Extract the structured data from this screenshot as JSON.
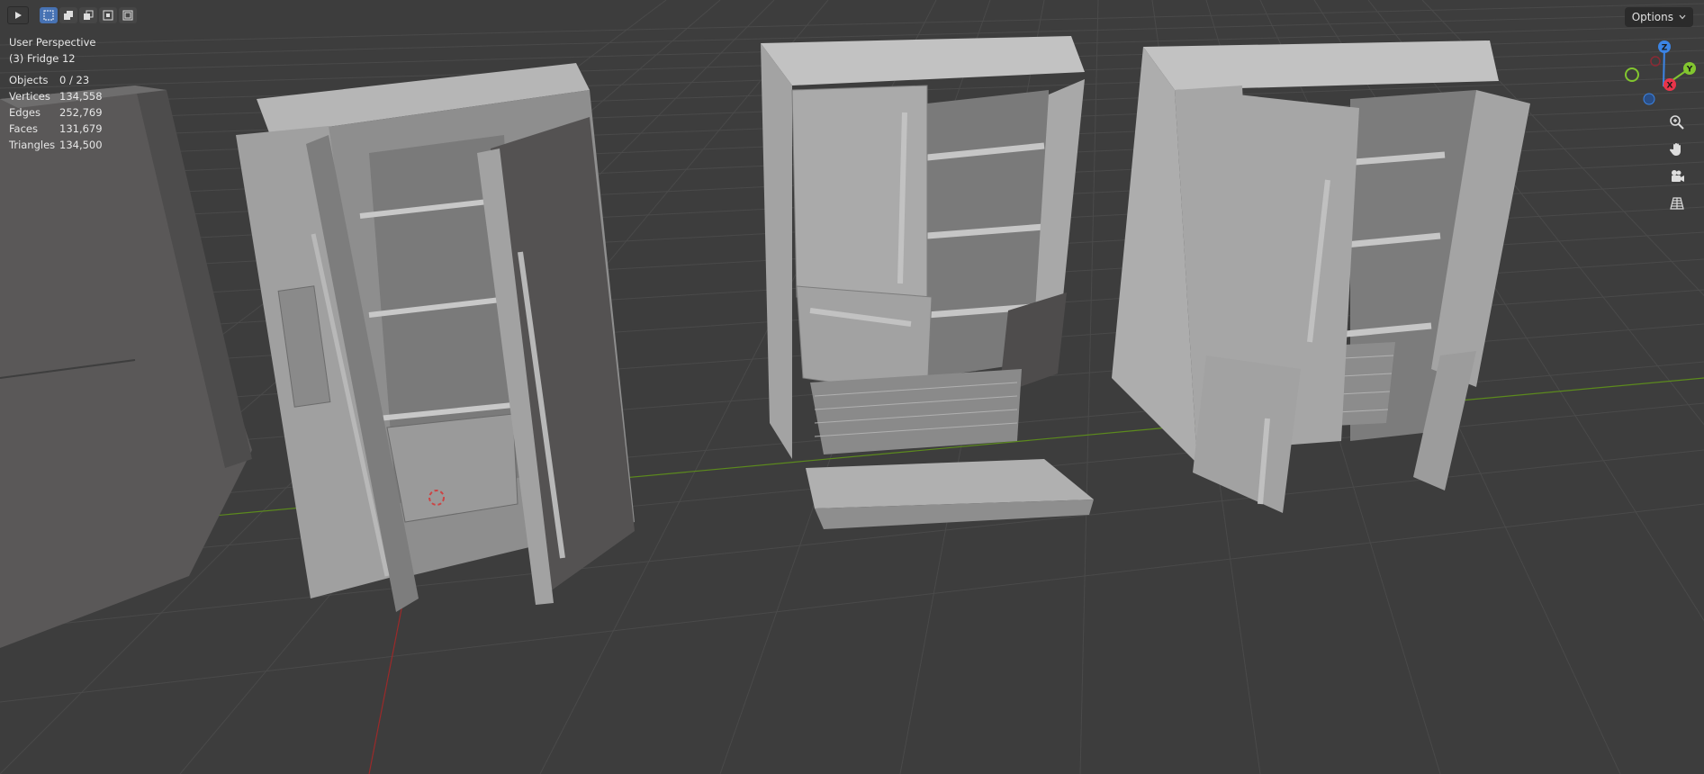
{
  "viewport": {
    "view_name": "User Perspective",
    "active_object": "(3) Fridge 12",
    "stats": [
      {
        "label": "Objects",
        "value": "0 / 23"
      },
      {
        "label": "Vertices",
        "value": "134,558"
      },
      {
        "label": "Edges",
        "value": "252,769"
      },
      {
        "label": "Faces",
        "value": "131,679"
      },
      {
        "label": "Triangles",
        "value": "134,500"
      }
    ]
  },
  "header": {
    "options_label": "Options",
    "mode_icon": "play-icon",
    "select_modes": [
      "select-new-icon",
      "select-extend-icon",
      "select-subtract-icon",
      "select-difference-icon",
      "select-intersect-icon"
    ]
  },
  "gizmo": {
    "z_label": "Z",
    "y_label": "Y",
    "x_label": "X",
    "colors": {
      "x": "#e8344a",
      "y": "#82c62f",
      "z": "#3b84e5"
    }
  },
  "nav_buttons": [
    "zoom-icon",
    "hand-pan-icon",
    "camera-icon",
    "grid-perspective-icon"
  ],
  "colors": {
    "background": "#3d3d3d",
    "grid": "#4a4a4a",
    "x_axis": "#9b2a2a",
    "y_axis": "#5c8a1d",
    "model": "#a8a8a8"
  }
}
